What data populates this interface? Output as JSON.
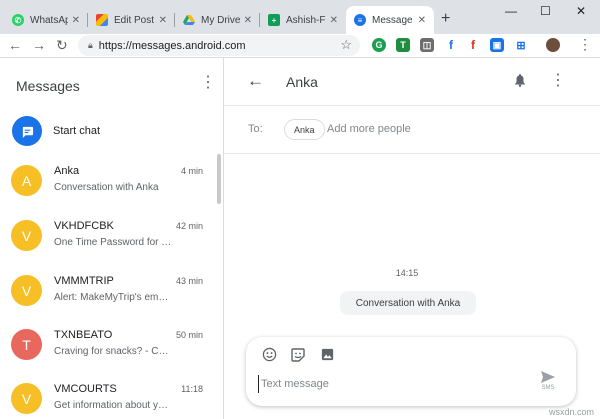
{
  "browser": {
    "tabs": [
      {
        "title": "WhatsApp",
        "favicon": "whatsapp-icon",
        "color": "#25d366"
      },
      {
        "title": "Edit Post",
        "favicon": "wordpress-icon",
        "color": "#7b5bbe"
      },
      {
        "title": "My Drive",
        "favicon": "drive-icon",
        "color": "#1fa463"
      },
      {
        "title": "Ashish-Fr",
        "favicon": "sheets-icon",
        "color": "#0f9d58"
      },
      {
        "title": "Message",
        "favicon": "messages-icon",
        "color": "#1a73e8",
        "active": true
      }
    ],
    "new_tab_glyph": "+",
    "url": "https://messages.android.com"
  },
  "sidebar": {
    "title": "Messages",
    "start_chat_label": "Start chat",
    "conversations": [
      {
        "name": "Anka",
        "snippet": "Conversation with Anka",
        "time": "4 min",
        "initial": "A",
        "color": "#f6bf26"
      },
      {
        "name": "VKHDFCBK",
        "snippet": "One Time Password for …",
        "time": "42 min",
        "initial": "V",
        "color": "#f6bf26"
      },
      {
        "name": "VMMMTRIP",
        "snippet": "Alert: MakeMyTrip's em…",
        "time": "43 min",
        "initial": "V",
        "color": "#f6bf26"
      },
      {
        "name": "TXNBEATO",
        "snippet": "Craving for snacks? - Ch…",
        "time": "50 min",
        "initial": "T",
        "color": "#e8685d"
      },
      {
        "name": "VMCOURTS",
        "snippet": "Get information about y…",
        "time": "11:18",
        "initial": "V",
        "color": "#f6bf26"
      }
    ]
  },
  "conversation": {
    "contact": "Anka",
    "to_label": "To:",
    "recipient_chip": "Anka",
    "add_people_placeholder": "Add more people",
    "timestamp": "14:15",
    "message": "Conversation with Anka",
    "composer_placeholder": "Text message",
    "send_label": "SMS"
  },
  "watermark": "wsxdn.com",
  "colors": {
    "accent": "#1a73e8"
  }
}
